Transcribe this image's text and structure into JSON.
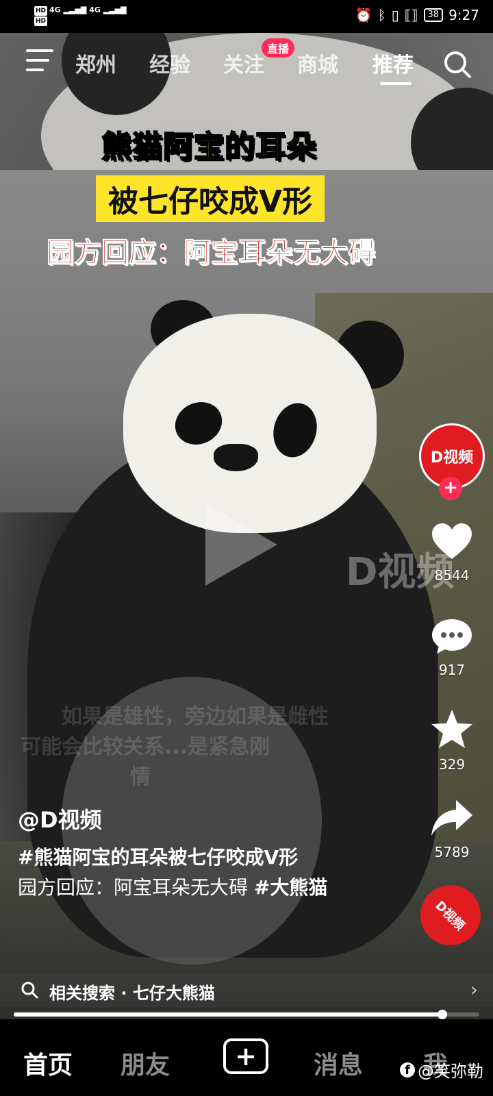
{
  "status_bar": {
    "left_labels": [
      "HD",
      "4G",
      "4G",
      "HD"
    ],
    "battery": "38",
    "time": "9:27"
  },
  "top_nav": {
    "tabs": [
      "郑州",
      "经验",
      "关注",
      "商城",
      "推荐"
    ],
    "live_badge": "直播",
    "active_tab": "推荐"
  },
  "video": {
    "title_line1": "熊猫阿宝的耳朵",
    "title_line2": "被七仔咬成V形",
    "title_line3": "园方回应：阿宝耳朵无大碍",
    "watermark": "D视频",
    "ghost_subtitle_line1": "如果是雄性，旁边如果是雌性",
    "ghost_subtitle_line2": "可能会比较关系...是紧急刚",
    "ghost_subtitle_line3": "情"
  },
  "right_rail": {
    "avatar_label": "D视频",
    "follow_plus": "+",
    "likes": "8544",
    "comments": "917",
    "favorites": "329",
    "shares": "5789",
    "disc_label": "D视频"
  },
  "caption": {
    "author": "@D视频",
    "hashtag_line": "#熊猫阿宝的耳朵被七仔咬成V形",
    "body_text": "园方回应：阿宝耳朵无大碍",
    "body_tag": "#大熊猫"
  },
  "related_search": {
    "label": "相关搜索 · 七仔大熊猫",
    "arrow": "›"
  },
  "playback": {
    "progress_fraction": 0.92
  },
  "bottom_nav": {
    "home": "首页",
    "friends": "朋友",
    "create": "+",
    "messages": "消息",
    "me": "我"
  },
  "credit": {
    "fb": "f",
    "text": "@笑弥勒"
  }
}
